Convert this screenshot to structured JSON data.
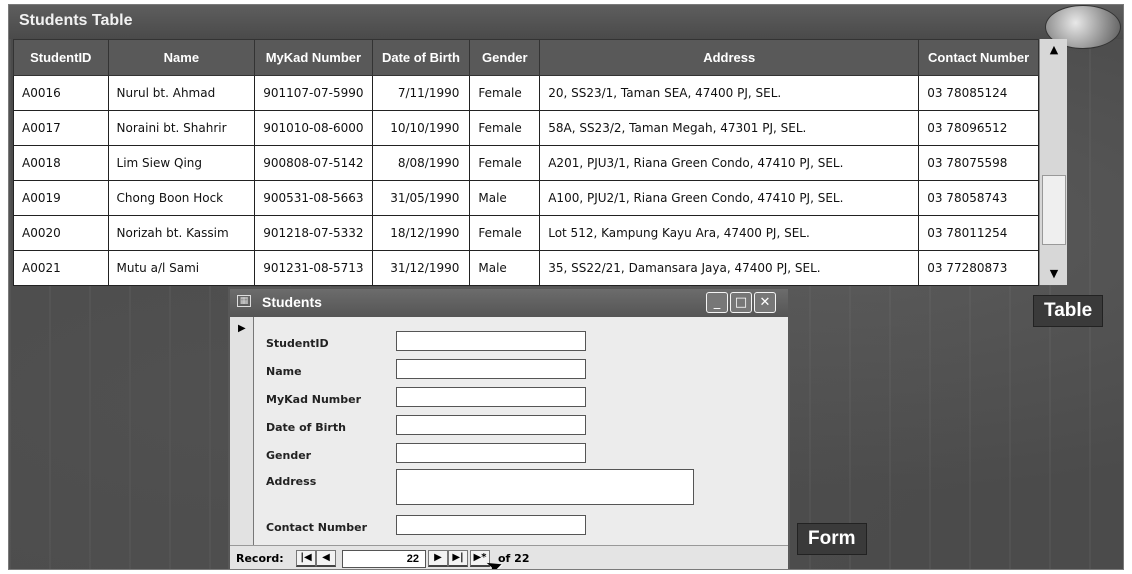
{
  "window": {
    "title": "Students Table"
  },
  "table": {
    "columns": [
      "StudentID",
      "Name",
      "MyKad Number",
      "Date of Birth",
      "Gender",
      "Address",
      "Contact Number"
    ],
    "rows": [
      [
        "A0016",
        "Nurul bt. Ahmad",
        "901107-07-5990",
        "7/11/1990",
        "Female",
        "20, SS23/1, Taman SEA, 47400 PJ, SEL.",
        "03 78085124"
      ],
      [
        "A0017",
        "Noraini bt. Shahrir",
        "901010-08-6000",
        "10/10/1990",
        "Female",
        "58A, SS23/2, Taman Megah, 47301 PJ, SEL.",
        "03 78096512"
      ],
      [
        "A0018",
        "Lim Siew Qing",
        "900808-07-5142",
        "8/08/1990",
        "Female",
        "A201, PJU3/1, Riana Green Condo, 47410 PJ, SEL.",
        "03 78075598"
      ],
      [
        "A0019",
        "Chong Boon Hock",
        "900531-08-5663",
        "31/05/1990",
        "Male",
        "A100, PJU2/1, Riana Green Condo, 47410 PJ, SEL.",
        "03 78058743"
      ],
      [
        "A0020",
        "Norizah bt. Kassim",
        "901218-07-5332",
        "18/12/1990",
        "Female",
        "Lot 512, Kampung Kayu Ara, 47400 PJ, SEL.",
        "03 78011254"
      ],
      [
        "A0021",
        "Mutu a/l Sami",
        "901231-08-5713",
        "31/12/1990",
        "Male",
        "35, SS22/21, Damansara Jaya, 47400 PJ, SEL.",
        "03 77280873"
      ]
    ]
  },
  "labels": {
    "table": "Table",
    "form": "Form"
  },
  "form": {
    "title": "Students",
    "icon": "form-icon",
    "fields": [
      {
        "label": "StudentID",
        "value": ""
      },
      {
        "label": "Name",
        "value": ""
      },
      {
        "label": "MyKad Number",
        "value": ""
      },
      {
        "label": "Date of Birth",
        "value": ""
      },
      {
        "label": "Gender",
        "value": ""
      },
      {
        "label": "Address",
        "value": ""
      },
      {
        "label": "Contact Number",
        "value": ""
      }
    ],
    "nav": {
      "record_label": "Record:",
      "current": "22",
      "total": "of 22",
      "first": "|◀",
      "prev": "◀",
      "next": "▶",
      "last": "▶|",
      "new": "▶*"
    }
  },
  "colors": {
    "header_bg": "#595959",
    "background": "#4b4b4b"
  }
}
